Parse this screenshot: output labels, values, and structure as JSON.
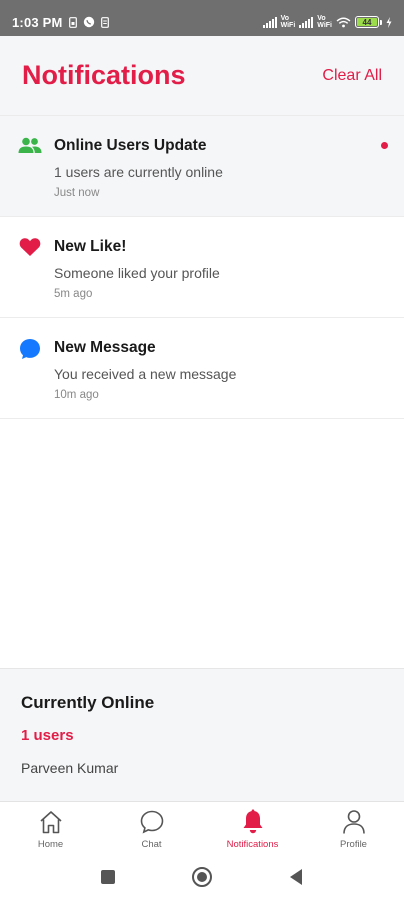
{
  "status_bar": {
    "time": "1:03 PM",
    "volte_top": "Vo",
    "volte_bottom": "WiFi",
    "volte2_top": "Vo",
    "volte2_bottom": "WiFi",
    "battery": "44"
  },
  "header": {
    "title": "Notifications",
    "clear_all": "Clear All"
  },
  "notifications": [
    {
      "title": "Online Users Update",
      "message": "1 users are currently online",
      "time": "Just now",
      "icon": "users-icon",
      "icon_color": "#3bb54a",
      "unread": true
    },
    {
      "title": "New Like!",
      "message": "Someone liked your profile",
      "time": "5m ago",
      "icon": "heart-icon",
      "icon_color": "#e11d48",
      "unread": false
    },
    {
      "title": "New Message",
      "message": "You received a new message",
      "time": "10m ago",
      "icon": "chat-bubble-icon",
      "icon_color": "#1479ff",
      "unread": false
    }
  ],
  "online_panel": {
    "title": "Currently Online",
    "count": "1 users",
    "users": [
      "Parveen Kumar"
    ]
  },
  "bottom_nav": {
    "items": [
      {
        "label": "Home",
        "icon": "home-icon",
        "active": false
      },
      {
        "label": "Chat",
        "icon": "chat-icon",
        "active": false
      },
      {
        "label": "Notifications",
        "icon": "bell-icon",
        "active": true
      },
      {
        "label": "Profile",
        "icon": "profile-icon",
        "active": false
      }
    ]
  },
  "colors": {
    "accent": "#e11d48",
    "header_bg": "#f5f6f8",
    "status_bar_bg": "#6f6f6f"
  }
}
